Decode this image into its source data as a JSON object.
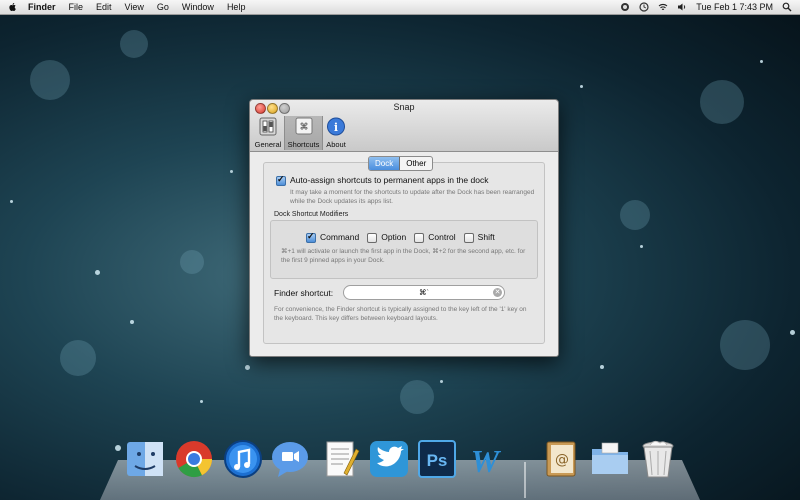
{
  "menubar": {
    "app_name": "Finder",
    "items": [
      "File",
      "Edit",
      "View",
      "Go",
      "Window",
      "Help"
    ],
    "clock": "Tue Feb 1  7:43 PM",
    "right_icons": [
      "snap-status-icon",
      "time-machine-icon",
      "wifi-icon",
      "volume-icon",
      "spotlight-icon"
    ]
  },
  "window": {
    "title": "Snap",
    "toolbar": [
      {
        "label": "General",
        "icon": "general-switch-icon",
        "selected": false
      },
      {
        "label": "Shortcuts",
        "icon": "command-key-icon",
        "selected": true
      },
      {
        "label": "About",
        "icon": "info-icon",
        "selected": false
      }
    ],
    "segments": {
      "dock": "Dock",
      "other": "Other",
      "selected": "Dock"
    },
    "auto_assign": {
      "label": "Auto-assign shortcuts to permanent apps in the dock",
      "checked": true,
      "note": "It may take a moment for the shortcuts to update after the Dock has been rearranged while the Dock updates its apps list."
    },
    "modifiers_group": {
      "label": "Dock Shortcut Modifiers",
      "items": [
        {
          "label": "Command",
          "checked": true
        },
        {
          "label": "Option",
          "checked": false
        },
        {
          "label": "Control",
          "checked": false
        },
        {
          "label": "Shift",
          "checked": false
        }
      ],
      "note": "⌘+1 will activate or launch the first app in the Dock, ⌘+2 for the second app, etc. for the first 9 pinned apps in your Dock."
    },
    "finder_shortcut": {
      "label": "Finder shortcut:",
      "value": "⌘`",
      "note": "For convenience, the Finder shortcut is typically assigned to the key left of the '1' key on the keyboard. This key differs between keyboard layouts."
    }
  },
  "dock": {
    "apps": [
      "finder-icon",
      "chrome-icon",
      "itunes-icon",
      "ichat-icon",
      "textedit-icon",
      "twitter-icon",
      "photoshop-icon",
      "word-icon",
      "address-book-icon",
      "folder-icon",
      "trash-icon"
    ]
  }
}
